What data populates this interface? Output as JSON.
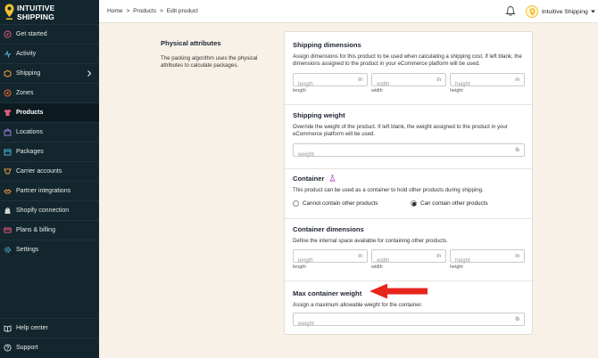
{
  "brand": {
    "line1": "INTUITIVE",
    "line2": "SHIPPING"
  },
  "sidebar": {
    "items": [
      {
        "label": "Get started",
        "icon": "compass-icon"
      },
      {
        "label": "Activity",
        "icon": "activity-icon"
      },
      {
        "label": "Shipping",
        "icon": "shipping-icon"
      },
      {
        "label": "Zones",
        "icon": "zones-icon"
      },
      {
        "label": "Products",
        "icon": "shirt-icon"
      },
      {
        "label": "Locations",
        "icon": "locations-icon"
      },
      {
        "label": "Packages",
        "icon": "package-icon"
      },
      {
        "label": "Carrier accounts",
        "icon": "carrier-icon"
      },
      {
        "label": "Partner integrations",
        "icon": "partner-icon"
      },
      {
        "label": "Shopify connection",
        "icon": "shopify-icon"
      },
      {
        "label": "Plans & billing",
        "icon": "billing-icon"
      },
      {
        "label": "Settings",
        "icon": "gear-icon"
      }
    ],
    "bottom": [
      {
        "label": "Help center",
        "icon": "book-icon"
      },
      {
        "label": "Support",
        "icon": "help-icon"
      }
    ]
  },
  "header": {
    "breadcrumb": [
      "Home",
      ">",
      "Products",
      ">",
      "Edit product"
    ],
    "account_name": "Intuitive Shipping"
  },
  "intro": {
    "title": "Physical attributes",
    "text": "The packing algorithm uses the physical attributes to calculate packages."
  },
  "shipping_dimensions": {
    "title": "Shipping dimensions",
    "text": "Assign dimensions for this product to be used when calculating a shipping cost. If left blank, the dimensions assigned to the product in your eCommerce platform will be used.",
    "fields": [
      {
        "placeholder": "length",
        "unit": "in",
        "label": "length"
      },
      {
        "placeholder": "width",
        "unit": "in",
        "label": "width"
      },
      {
        "placeholder": "height",
        "unit": "in",
        "label": "height"
      }
    ]
  },
  "shipping_weight": {
    "title": "Shipping weight",
    "text": "Override the weight of the product. If left blank, the weight assigned to the product in your eCommerce platform will be used.",
    "placeholder": "weight",
    "unit": "lb"
  },
  "container": {
    "title": "Container",
    "text": "This product can be used as a container to hold other products during shipping.",
    "option_no": "Cannot contain other products",
    "option_yes": "Can contain other products",
    "selected": "Can contain other products"
  },
  "container_dimensions": {
    "title": "Container dimensions",
    "text": "Define the internal space available for containing other products.",
    "fields": [
      {
        "placeholder": "length",
        "unit": "in",
        "label": "length"
      },
      {
        "placeholder": "width",
        "unit": "in",
        "label": "width"
      },
      {
        "placeholder": "height",
        "unit": "in",
        "label": "height"
      }
    ]
  },
  "max_container_weight": {
    "title": "Max container weight",
    "text": "Assign a maximum allowable weight for the container.",
    "placeholder": "weight",
    "unit": "lb"
  },
  "colors": {
    "sidebar": "#13252d",
    "background": "#f7f1e8",
    "accent_yellow": "#f2c230",
    "arrow_red": "#e8261c"
  }
}
